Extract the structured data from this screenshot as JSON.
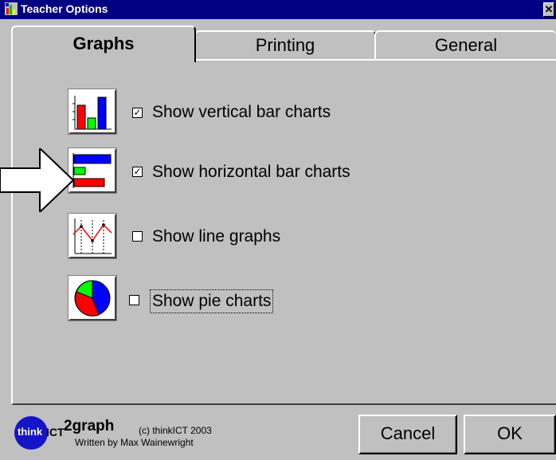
{
  "window": {
    "title": "Teacher Options",
    "close_glyph": "✕"
  },
  "tabs": [
    {
      "label": "Graphs",
      "active": true
    },
    {
      "label": "Printing",
      "active": false
    },
    {
      "label": "General",
      "active": false
    }
  ],
  "options": [
    {
      "label": "Show vertical bar charts",
      "checked": true,
      "icon": "vertical-bar-chart-icon"
    },
    {
      "label": "Show horizontal bar charts",
      "checked": true,
      "icon": "horizontal-bar-chart-icon"
    },
    {
      "label": "Show line graphs",
      "checked": false,
      "icon": "line-graph-icon"
    },
    {
      "label": "Show pie charts",
      "checked": false,
      "icon": "pie-chart-icon"
    }
  ],
  "checkmark": "✓",
  "footer": {
    "logo_think": "think",
    "logo_ict": "ICT",
    "app_name": "2graph",
    "copyright": "(c) thinkICT 2003",
    "author": "Written by Max Wainewright"
  },
  "buttons": {
    "cancel": "Cancel",
    "ok": "OK"
  },
  "colors": {
    "titlebar": "#000080",
    "face": "#c0c0c0",
    "logo": "#1414c8"
  }
}
